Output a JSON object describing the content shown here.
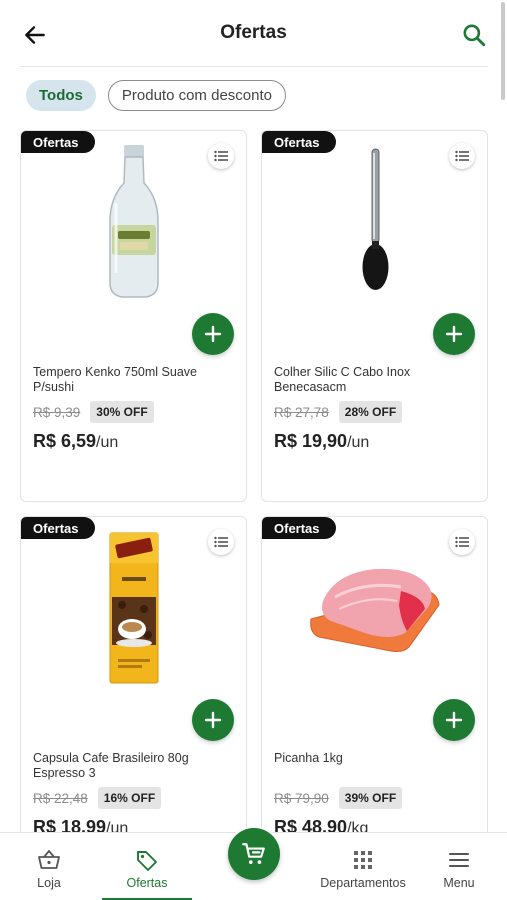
{
  "header": {
    "title": "Ofertas",
    "back_icon": "arrow-left-icon",
    "search_icon": "search-icon"
  },
  "filters": [
    {
      "label": "Todos",
      "active": true
    },
    {
      "label": "Produto com desconto",
      "active": false
    }
  ],
  "products": [
    {
      "tag": "Ofertas",
      "name": "Tempero Kenko 750ml Suave P/sushi",
      "old_price": "R$ 9,39",
      "discount": "30% OFF",
      "price": "R$ 6,59",
      "unit": "/un",
      "image": "bottle-image"
    },
    {
      "tag": "Ofertas",
      "name": "Colher Silic C Cabo Inox Benecasacm",
      "old_price": "R$ 27,78",
      "discount": "28% OFF",
      "price": "R$ 19,90",
      "unit": "/un",
      "image": "spoon-image"
    },
    {
      "tag": "Ofertas",
      "name": "Capsula Cafe Brasileiro 80g Espresso 3",
      "old_price": "R$ 22,48",
      "discount": "16% OFF",
      "price": "R$ 18,99",
      "unit": "/un",
      "image": "coffee-box-image"
    },
    {
      "tag": "Ofertas",
      "name": "Picanha 1kg",
      "old_price": "R$ 79,90",
      "discount": "39% OFF",
      "price": "R$ 48,90",
      "unit": "/kg",
      "image": "meat-image"
    }
  ],
  "nav": {
    "items": [
      {
        "label": "Loja",
        "icon": "basket-icon",
        "active": false
      },
      {
        "label": "Ofertas",
        "icon": "tag-icon",
        "active": true
      },
      {
        "label": "Departamentos",
        "icon": "grid-icon",
        "active": false
      },
      {
        "label": "Menu",
        "icon": "menu-icon",
        "active": false
      }
    ],
    "cart_icon": "cart-icon"
  },
  "colors": {
    "brand_green": "#1e7a32",
    "chip_active_bg": "#d6e4ee",
    "tag_bg": "#111111"
  }
}
